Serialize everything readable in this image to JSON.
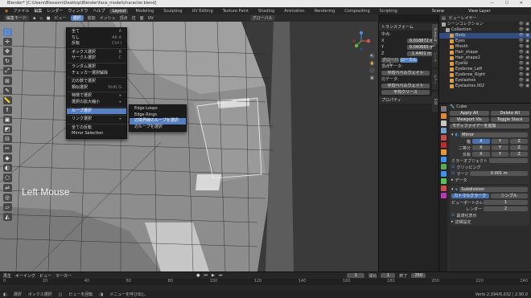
{
  "window": {
    "title": "Blender* [C:\\Users\\Blossom\\Desktop\\Blender\\face_model\\character.blend]",
    "controls": "— ☐ ✕"
  },
  "topbar": {
    "menus": [
      "ファイル",
      "編集",
      "レンダー",
      "ウィンドウ",
      "ヘルプ"
    ],
    "workspaces": [
      "Layout",
      "Modeling",
      "Sculpting",
      "UV Editing",
      "Texture Paint",
      "Shading",
      "Animation",
      "Rendering",
      "Compositing",
      "Scripting"
    ],
    "active_workspace": "Layout",
    "scene": "Scene",
    "view_layer": "View Layer"
  },
  "viewport_header": {
    "mode": "編集モード",
    "menus": [
      "ビュー",
      "選択",
      "追加",
      "メッシュ",
      "頂点",
      "辺",
      "面",
      "UV"
    ],
    "transform": "グローバル"
  },
  "overlay_text": "Left Mouse",
  "select_menu": {
    "items": [
      {
        "label": "全て",
        "shortcut": "A"
      },
      {
        "label": "なし",
        "shortcut": "Alt A"
      },
      {
        "label": "反転",
        "shortcut": "Ctrl I"
      },
      {
        "sep": true
      },
      {
        "label": "ボックス選択",
        "shortcut": "B"
      },
      {
        "label": "サークル選択",
        "shortcut": "C"
      },
      {
        "sep": true
      },
      {
        "label": "ランダム選択",
        "shortcut": ""
      },
      {
        "label": "チェッカー選択解除",
        "shortcut": ""
      },
      {
        "sep": true
      },
      {
        "label": "辺の数で選択",
        "shortcut": ""
      },
      {
        "label": "類似選択",
        "shortcut": "Shift G"
      },
      {
        "sep": true
      },
      {
        "label": "特徴で選択",
        "shortcut": "▸"
      },
      {
        "label": "選択の拡大縮小",
        "shortcut": "▸"
      },
      {
        "sep": true
      },
      {
        "label": "ループ選択",
        "shortcut": "▸",
        "hl": true
      },
      {
        "sep": true
      },
      {
        "label": "リンク選択",
        "shortcut": "▸"
      },
      {
        "sep": true
      },
      {
        "label": "全ての反転",
        "shortcut": ""
      },
      {
        "label": "Mirror Selection",
        "shortcut": ""
      }
    ]
  },
  "loop_submenu": {
    "items": [
      {
        "label": "Edge Loops",
        "hl": false
      },
      {
        "label": "Edge Rings",
        "hl": false
      },
      {
        "label": "辺境界線のループを選択",
        "hl": true
      },
      {
        "label": "辺ループを選択",
        "hl": false
      }
    ]
  },
  "n_panel": {
    "transform_header": "トランスフォーム",
    "median_label": "中点:",
    "fields": [
      {
        "label": "X",
        "value": "0.018872 m"
      },
      {
        "label": "Y",
        "value": "0.040665 m"
      },
      {
        "label": "Z",
        "value": "1.4401 m"
      }
    ],
    "toggle": [
      "グローバル",
      "ローカル"
    ],
    "vertex_data": "頂点データ:",
    "bevel_weight": "平均ベベルウェイト",
    "edge_data": "辺データ:",
    "edge_bevel": "平均ベベルウェイト",
    "crease": "平均クリース",
    "properties": "プロパティ",
    "tabs": [
      "アイテム",
      "ツール",
      "ビュー",
      "Edit"
    ]
  },
  "outliner": {
    "header": "ビューレイヤー",
    "items": [
      {
        "label": "シーンコレクション",
        "color": "#aaaaaa",
        "sel": false
      },
      {
        "label": "Collection",
        "color": "#aaaaaa",
        "sel": false
      },
      {
        "label": "Body",
        "color": "#e39a3b",
        "sel": true
      },
      {
        "label": "Eyes",
        "color": "#e39a3b",
        "sel": false
      },
      {
        "label": "Mouth",
        "color": "#e39a3b",
        "sel": false
      },
      {
        "label": "Hair_shape",
        "color": "#e39a3b",
        "sel": false
      },
      {
        "label": "Hair_shape2",
        "color": "#e39a3b",
        "sel": false
      },
      {
        "label": "Eyelid",
        "color": "#e39a3b",
        "sel": false
      },
      {
        "label": "Eyebrow_Left",
        "color": "#e39a3b",
        "sel": false
      },
      {
        "label": "Eyebrow_Right",
        "color": "#e39a3b",
        "sel": false
      },
      {
        "label": "Eyelashes",
        "color": "#e39a3b",
        "sel": false
      },
      {
        "label": "Eyelashes.002",
        "color": "#e39a3b",
        "sel": false
      }
    ]
  },
  "properties": {
    "object": "Cube",
    "apply_row": [
      "Apply All",
      "Delete All"
    ],
    "viewport_row": [
      "Viewport Vis",
      "Toggle Stack"
    ],
    "add_modifier": "モディファイアーを追加",
    "mirror": {
      "name": "Mirror",
      "axis_label": "軸",
      "bisect_label": "二等分",
      "flip_label": "反転",
      "axes": [
        "X",
        "Y",
        "Z"
      ],
      "mirror_object": "ミラーオブジェクト",
      "clipping": "クリッピング",
      "merge": "マージ",
      "merge_value": "0.001 m",
      "data": "データ"
    },
    "subdivision": {
      "name": "Subdivision",
      "tabs": [
        "カトマルクラーク",
        "シンプル"
      ],
      "levels_viewport_label": "ビューポートのレベル",
      "levels_viewport": "1",
      "render_label": "レンダー",
      "render": "2",
      "optimal": "最適化表示",
      "advanced": "詳細設定"
    }
  },
  "timeline": {
    "menus": [
      "再生",
      "キーイング",
      "ビュー",
      "マーカー"
    ],
    "frame": "1",
    "start_label": "開始",
    "start": "1",
    "end_label": "終了",
    "end": "250",
    "ticks": [
      "0",
      "20",
      "40",
      "60",
      "80",
      "100",
      "120",
      "140",
      "160",
      "180",
      "200",
      "220",
      "240"
    ]
  },
  "statusbar": {
    "items": [
      "選択",
      "ボックス選択",
      "ビューを回転",
      "メニューを呼び出し"
    ],
    "version": "Verts 2,394/6,032 | 2.90.0"
  }
}
